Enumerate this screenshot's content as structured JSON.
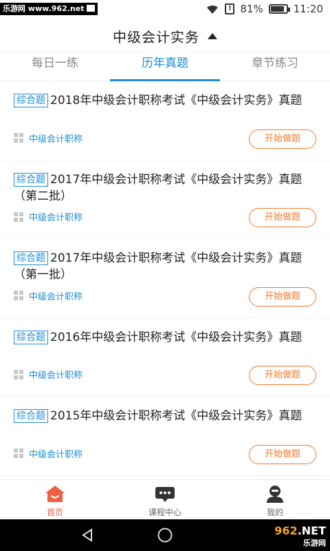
{
  "status_bar": {
    "watermark": "乐游网 www.962.net",
    "battery_percent": "81%",
    "time": "11:20",
    "battery_alert": "!"
  },
  "header": {
    "title": "中级会计实务"
  },
  "tabs": [
    {
      "label": "每日一练",
      "active": false
    },
    {
      "label": "历年真题",
      "active": true
    },
    {
      "label": "章节练习",
      "active": false
    }
  ],
  "items": [
    {
      "tag": "综合题",
      "title": "2018年中级会计职称考试《中级会计实务》真题",
      "category": "中级会计职称",
      "button": "开始做题"
    },
    {
      "tag": "综合题",
      "title": "2017年中级会计职称考试《中级会计实务》真题（第二批）",
      "category": "中级会计职称",
      "button": "开始做题"
    },
    {
      "tag": "综合题",
      "title": "2017年中级会计职称考试《中级会计实务》真题（第一批）",
      "category": "中级会计职称",
      "button": "开始做题"
    },
    {
      "tag": "综合题",
      "title": "2016年中级会计职称考试《中级会计实务》真题",
      "category": "中级会计职称",
      "button": "开始做题"
    },
    {
      "tag": "综合题",
      "title": "2015年中级会计职称考试《中级会计实务》真题",
      "category": "中级会计职称",
      "button": "开始做题"
    }
  ],
  "bottom_nav": [
    {
      "label": "首页",
      "icon": "home-icon",
      "active": true
    },
    {
      "label": "课程中心",
      "icon": "course-icon",
      "active": false
    },
    {
      "label": "我的",
      "icon": "profile-icon",
      "active": false
    }
  ],
  "colors": {
    "accent": "#1a8dd6",
    "button": "#f07a2a",
    "nav_active": "#ee5f44"
  },
  "system_watermark": {
    "prefix": "962",
    "suffix": ".NET",
    "sub": "乐游网"
  }
}
